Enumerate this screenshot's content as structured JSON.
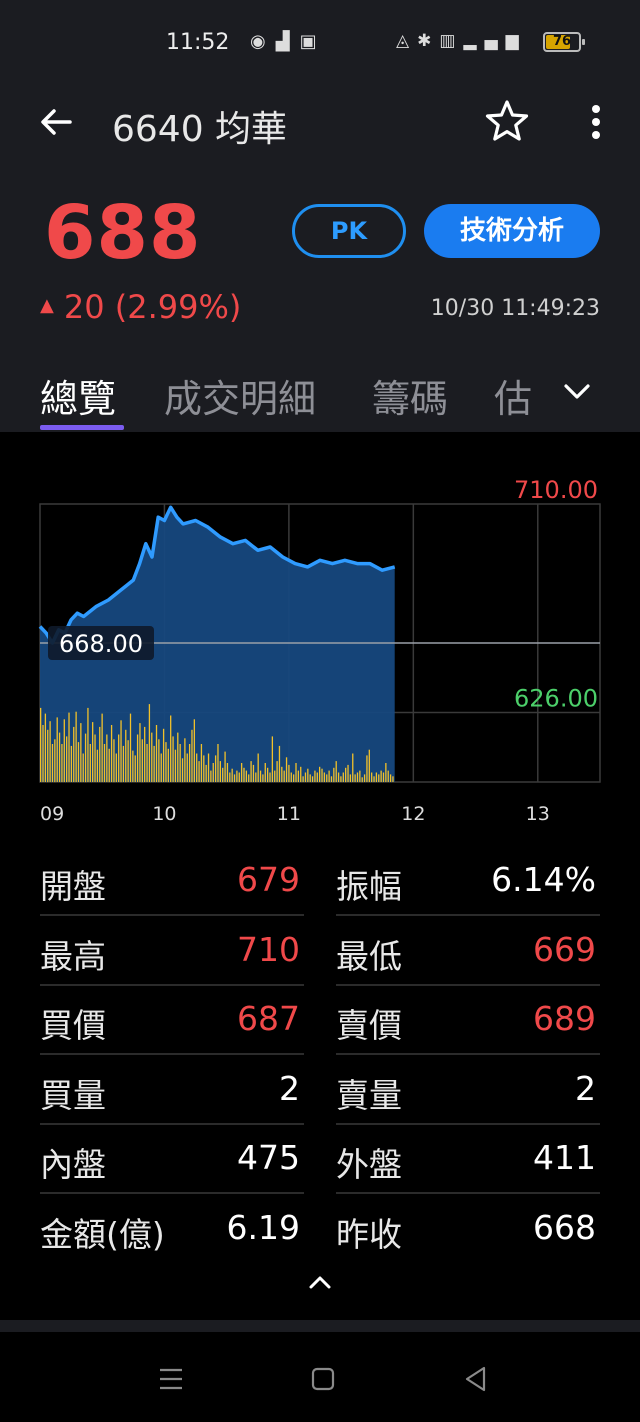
{
  "status_bar": {
    "time": "11:52",
    "battery": "76",
    "battery_level": 0.76,
    "left_icons": [
      "messenger-icon",
      "signal-chart-icon",
      "app-notification-icon"
    ],
    "right_icons": [
      "mute-icon",
      "bluetooth-icon",
      "volte-icon",
      "4g-signal-icon",
      "battery-icon"
    ]
  },
  "header": {
    "title": "6640 均華",
    "back_icon": "arrow-left-icon",
    "favorite_icon": "star-outline-icon",
    "more_icon": "more-vertical-icon"
  },
  "quote": {
    "price": "688",
    "change": "20 (2.99%)",
    "direction_icon": "triangle-up-icon",
    "timestamp": "10/30 11:49:23",
    "pk_label": "PK",
    "technical_label": "技術分析"
  },
  "tabs": {
    "items": [
      {
        "label": "總覽",
        "active": true
      },
      {
        "label": "成交明細",
        "active": false
      },
      {
        "label": "籌碼",
        "active": false
      },
      {
        "label": "估",
        "active": false
      }
    ],
    "more_icon": "chevron-down-icon"
  },
  "chart_data": {
    "type": "area",
    "ylim": [
      626,
      710
    ],
    "y_labels": {
      "high": "710.00",
      "ref": "668.00",
      "low": "626.00"
    },
    "x_tick_labels": [
      "09",
      "10",
      "11",
      "12",
      "13"
    ],
    "price_series": [
      [
        9.0,
        673
      ],
      [
        9.05,
        671
      ],
      [
        9.1,
        668
      ],
      [
        9.15,
        672
      ],
      [
        9.2,
        671
      ],
      [
        9.25,
        675
      ],
      [
        9.3,
        677
      ],
      [
        9.35,
        676
      ],
      [
        9.45,
        679
      ],
      [
        9.55,
        681
      ],
      [
        9.65,
        684
      ],
      [
        9.75,
        687
      ],
      [
        9.8,
        692
      ],
      [
        9.85,
        698
      ],
      [
        9.9,
        694
      ],
      [
        9.95,
        706
      ],
      [
        10.0,
        705
      ],
      [
        10.05,
        709
      ],
      [
        10.1,
        706
      ],
      [
        10.15,
        704
      ],
      [
        10.25,
        705
      ],
      [
        10.35,
        703
      ],
      [
        10.45,
        700
      ],
      [
        10.55,
        698
      ],
      [
        10.65,
        699
      ],
      [
        10.75,
        696
      ],
      [
        10.85,
        697
      ],
      [
        10.95,
        694
      ],
      [
        11.05,
        692
      ],
      [
        11.15,
        691
      ],
      [
        11.25,
        693
      ],
      [
        11.35,
        692
      ],
      [
        11.45,
        693
      ],
      [
        11.55,
        692
      ],
      [
        11.65,
        692
      ],
      [
        11.75,
        690
      ],
      [
        11.85,
        691
      ]
    ],
    "price_colors": {
      "up": "#f0494a",
      "down": "#4ccf6a",
      "line": "#2f9bff",
      "fill": "#16487e"
    },
    "volume_color": "#f2c12a",
    "volume_series": [
      0.78,
      0.6,
      0.72,
      0.55,
      0.64,
      0.4,
      0.45,
      0.68,
      0.52,
      0.4,
      0.66,
      0.48,
      0.73,
      0.38,
      0.58,
      0.74,
      0.42,
      0.62,
      0.3,
      0.51,
      0.78,
      0.4,
      0.63,
      0.5,
      0.34,
      0.58,
      0.72,
      0.4,
      0.5,
      0.35,
      0.6,
      0.45,
      0.3,
      0.5,
      0.65,
      0.38,
      0.55,
      0.44,
      0.72,
      0.33,
      0.28,
      0.5,
      0.62,
      0.45,
      0.58,
      0.4,
      0.82,
      0.52,
      0.38,
      0.6,
      0.45,
      0.3,
      0.56,
      0.42,
      0.35,
      0.7,
      0.48,
      0.34,
      0.52,
      0.4,
      0.25,
      0.46,
      0.3,
      0.4,
      0.55,
      0.66,
      0.3,
      0.22,
      0.4,
      0.28,
      0.18,
      0.3,
      0.12,
      0.2,
      0.28,
      0.4,
      0.22,
      0.15,
      0.32,
      0.2,
      0.1,
      0.14,
      0.08,
      0.12,
      0.1,
      0.2,
      0.15,
      0.12,
      0.08,
      0.22,
      0.18,
      0.1,
      0.3,
      0.12,
      0.08,
      0.2,
      0.15,
      0.1,
      0.48,
      0.12,
      0.22,
      0.38,
      0.16,
      0.12,
      0.26,
      0.18,
      0.1,
      0.08,
      0.2,
      0.12,
      0.16,
      0.06,
      0.1,
      0.14,
      0.08,
      0.06,
      0.12,
      0.1,
      0.16,
      0.14,
      0.1,
      0.08,
      0.12,
      0.06,
      0.15,
      0.22,
      0.1,
      0.06,
      0.1,
      0.15,
      0.18,
      0.08,
      0.3,
      0.08,
      0.1,
      0.12,
      0.05,
      0.08,
      0.28,
      0.34,
      0.1,
      0.06,
      0.1,
      0.08,
      0.12,
      0.1,
      0.2,
      0.12,
      0.08,
      0.06
    ]
  },
  "stats": [
    {
      "label": "開盤",
      "value": "679",
      "color": "red"
    },
    {
      "label": "振幅",
      "value": "6.14%",
      "color": "white"
    },
    {
      "label": "最高",
      "value": "710",
      "color": "red"
    },
    {
      "label": "最低",
      "value": "669",
      "color": "red"
    },
    {
      "label": "買價",
      "value": "687",
      "color": "red"
    },
    {
      "label": "賣價",
      "value": "689",
      "color": "red"
    },
    {
      "label": "買量",
      "value": "2",
      "color": "white"
    },
    {
      "label": "賣量",
      "value": "2",
      "color": "white"
    },
    {
      "label": "內盤",
      "value": "475",
      "color": "white"
    },
    {
      "label": "外盤",
      "value": "411",
      "color": "white"
    },
    {
      "label": "金額(億)",
      "value": "6.19",
      "color": "white"
    },
    {
      "label": "昨收",
      "value": "668",
      "color": "white"
    }
  ],
  "footer": {
    "collapse_icon": "chevron-up-icon",
    "nav_icons": [
      "recent-apps-icon",
      "home-icon",
      "back-icon"
    ]
  }
}
